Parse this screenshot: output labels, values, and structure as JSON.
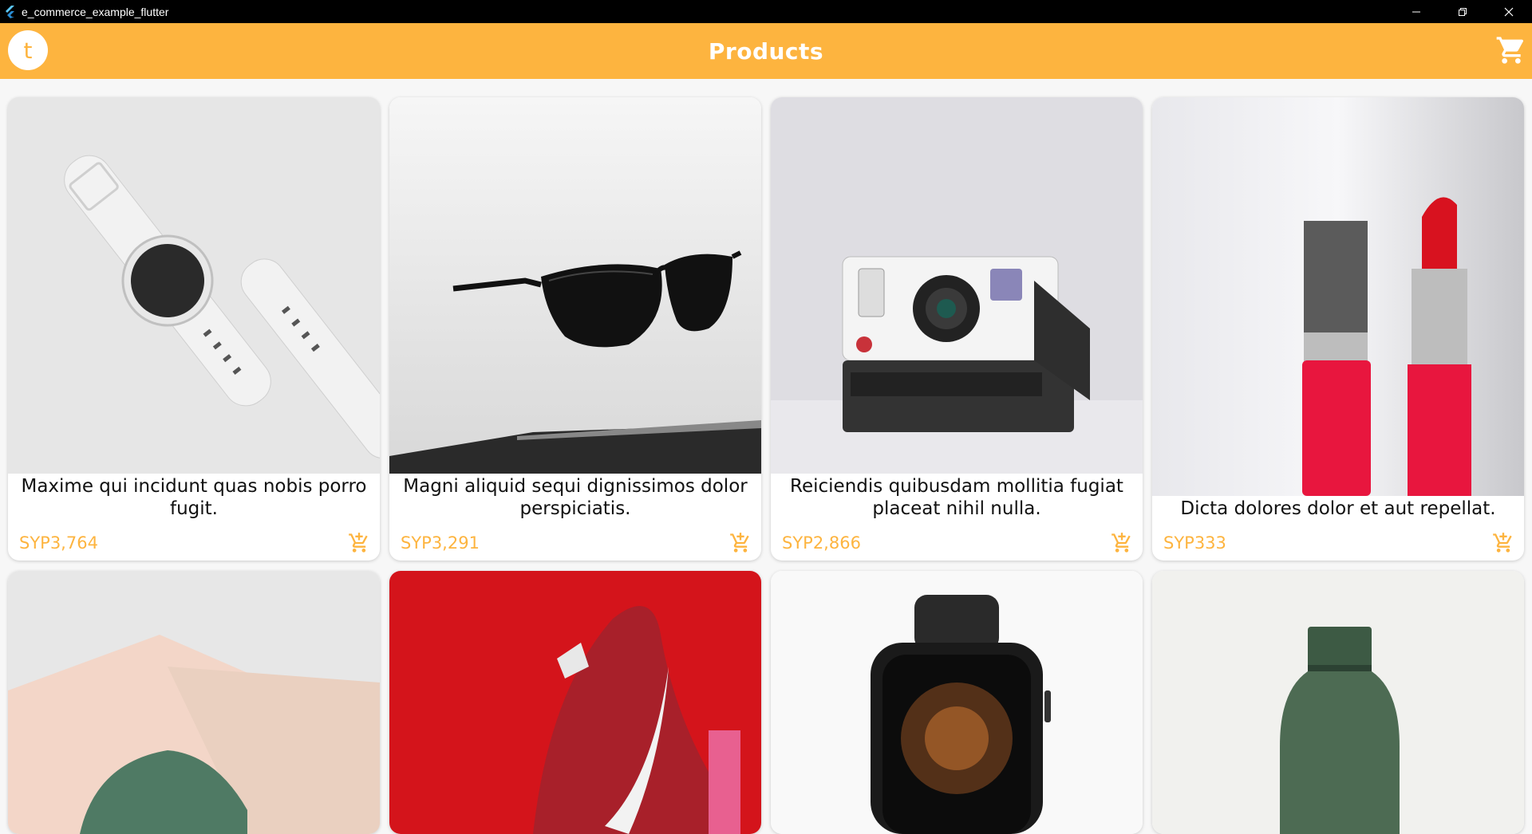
{
  "window": {
    "title": "e_commerce_example_flutter"
  },
  "appbar": {
    "avatar_letter": "t",
    "title": "Products"
  },
  "colors": {
    "accent": "#fdb43f",
    "title_bar": "#000000",
    "card": "#ffffff"
  },
  "products": [
    {
      "name": "Maxime qui incidunt quas nobis porro fugit.",
      "price": "SYP3,764",
      "icon": "smartwatch-white-image"
    },
    {
      "name": "Magni aliquid sequi dignissimos dolor perspiciatis.",
      "price": "SYP3,291",
      "icon": "sunglasses-image"
    },
    {
      "name": "Reiciendis quibusdam mollitia fugiat placeat nihil nulla.",
      "price": "SYP2,866",
      "icon": "polaroid-camera-image"
    },
    {
      "name": "Dicta dolores dolor et aut repellat.",
      "price": "SYP333",
      "icon": "lipstick-image"
    },
    {
      "name": "",
      "price": "",
      "icon": "green-shoe-image"
    },
    {
      "name": "",
      "price": "",
      "icon": "red-sneaker-image"
    },
    {
      "name": "",
      "price": "",
      "icon": "apple-watch-image"
    },
    {
      "name": "",
      "price": "",
      "icon": "green-bottle-image"
    }
  ]
}
